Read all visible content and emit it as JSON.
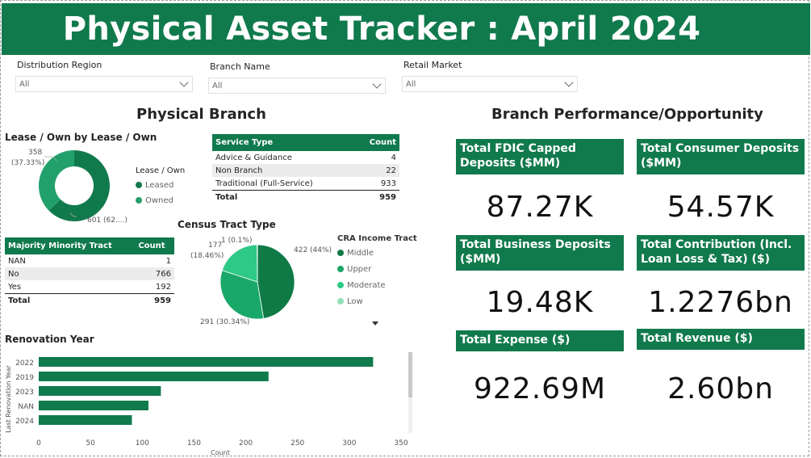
{
  "title": "Physical Asset Tracker : April 2024",
  "slicers": [
    {
      "label": "Distribution Region",
      "value": "All"
    },
    {
      "label": "Branch Name",
      "value": "All"
    },
    {
      "label": "Retail Market",
      "value": "All"
    }
  ],
  "left_section_title": "Physical Branch",
  "right_section_title": "Branch Performance/Opportunity",
  "lease_own": {
    "title": "Lease / Own by Lease / Own",
    "legend_title": "Lease / Own",
    "legend": [
      "Leased",
      "Owned"
    ],
    "label_owned_top": "358",
    "label_owned_pct": "(37.33%)",
    "label_leased": "601 (62....)",
    "colors": {
      "leased": "#117a4c",
      "owned": "#22a06b"
    },
    "chart_data": {
      "type": "pie",
      "categories": [
        "Leased",
        "Owned"
      ],
      "values": [
        601,
        358
      ]
    }
  },
  "service_type": {
    "headers": [
      "Service Type",
      "Count"
    ],
    "rows": [
      [
        "Advice & Guidance",
        "4"
      ],
      [
        "Non Branch",
        "22"
      ],
      [
        "Traditional (Full-Service)",
        "933"
      ]
    ],
    "total": [
      "Total",
      "959"
    ]
  },
  "census": {
    "title": "Census Tract Type",
    "labels": [
      "422 (44%)",
      "291 (30.34%)",
      "177",
      "(18.46%)",
      "1 (0.1%)"
    ],
    "legend_title": "CRA Income Tract",
    "legend": [
      "Middle",
      "Upper",
      "Moderate",
      "Low"
    ],
    "colors": [
      "#0f7a46",
      "#1aa86a",
      "#2ec987",
      "#8fe0b6"
    ],
    "chart_data": {
      "type": "pie",
      "categories": [
        "Middle",
        "Upper",
        "Moderate",
        "Low"
      ],
      "values": [
        422,
        291,
        177,
        1
      ]
    }
  },
  "minority": {
    "headers": [
      "Majority Minority Tract",
      "Count"
    ],
    "rows": [
      [
        "NAN",
        "1"
      ],
      [
        "No",
        "766"
      ],
      [
        "Yes",
        "192"
      ]
    ],
    "total": [
      "Total",
      "959"
    ]
  },
  "renovation": {
    "title": "Renovation Year",
    "ylabel": "Last Renovation Year",
    "xlabel": "Count",
    "color": "#117a4c",
    "chart_data": {
      "type": "bar",
      "categories": [
        "2022",
        "2019",
        "2023",
        "NAN",
        "2024"
      ],
      "values": [
        323,
        222,
        118,
        106,
        90
      ],
      "xlim": [
        0,
        350
      ],
      "ticks": [
        "0",
        "50",
        "100",
        "150",
        "200",
        "250",
        "300",
        "350"
      ]
    }
  },
  "kpis": [
    {
      "label": "Total FDIC Capped Deposits ($MM)",
      "value": "87.27K"
    },
    {
      "label": "Total Consumer Deposits ($MM)",
      "value": "54.57K"
    },
    {
      "label": "Total Business Deposits ($MM)",
      "value": "19.48K"
    },
    {
      "label": "Total Contribution (Incl. Loan Loss & Tax) ($)",
      "value": "1.2276bn"
    },
    {
      "label": "Total Expense ($)",
      "value": "922.69M"
    },
    {
      "label": "Total Revenue ($)",
      "value": "2.60bn"
    }
  ]
}
